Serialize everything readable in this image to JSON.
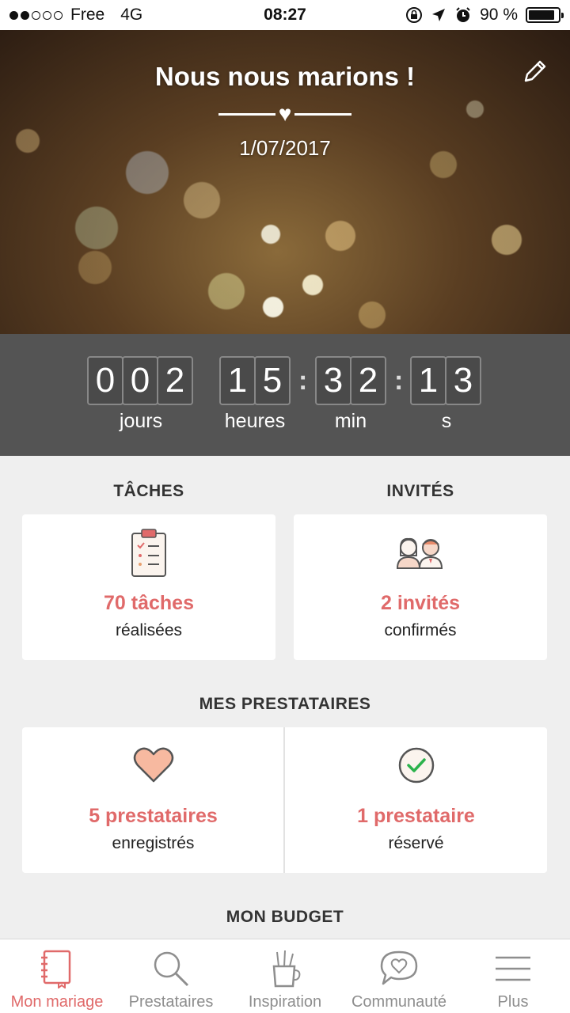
{
  "status_bar": {
    "carrier": "Free",
    "network": "4G",
    "time": "08:27",
    "battery": "90 %",
    "battery_level": 0.9
  },
  "hero": {
    "title": "Nous nous marions !",
    "date": "1/07/2017"
  },
  "countdown": {
    "days_digits": [
      "0",
      "0",
      "2"
    ],
    "hours_digits": [
      "1",
      "5"
    ],
    "minutes_digits": [
      "3",
      "2"
    ],
    "seconds_digits": [
      "1",
      "3"
    ],
    "days_label": "jours",
    "hours_label": "heures",
    "minutes_label": "min",
    "seconds_label": "s"
  },
  "tasks": {
    "title": "TÂCHES",
    "count": "70 tâches",
    "caption": "réalisées"
  },
  "guests": {
    "title": "INVITÉS",
    "count": "2 invités",
    "caption": "confirmés"
  },
  "vendors": {
    "title": "MES PRESTATAIRES",
    "saved_count": "5 prestataires",
    "saved_caption": "enregistrés",
    "booked_count": "1 prestataire",
    "booked_caption": "réservé"
  },
  "budget": {
    "title": "MON BUDGET"
  },
  "bottom_nav": {
    "items": [
      {
        "label": "Mon mariage",
        "icon": "notebook-icon",
        "active": true
      },
      {
        "label": "Prestataires",
        "icon": "search-icon",
        "active": false
      },
      {
        "label": "Inspiration",
        "icon": "pencil-cup-icon",
        "active": false
      },
      {
        "label": "Communauté",
        "icon": "chat-heart-icon",
        "active": false
      },
      {
        "label": "Plus",
        "icon": "menu-icon",
        "active": false
      }
    ]
  },
  "colors": {
    "accent": "#e06a6a",
    "countdown_bg": "#545454",
    "page_bg": "#efefef"
  }
}
